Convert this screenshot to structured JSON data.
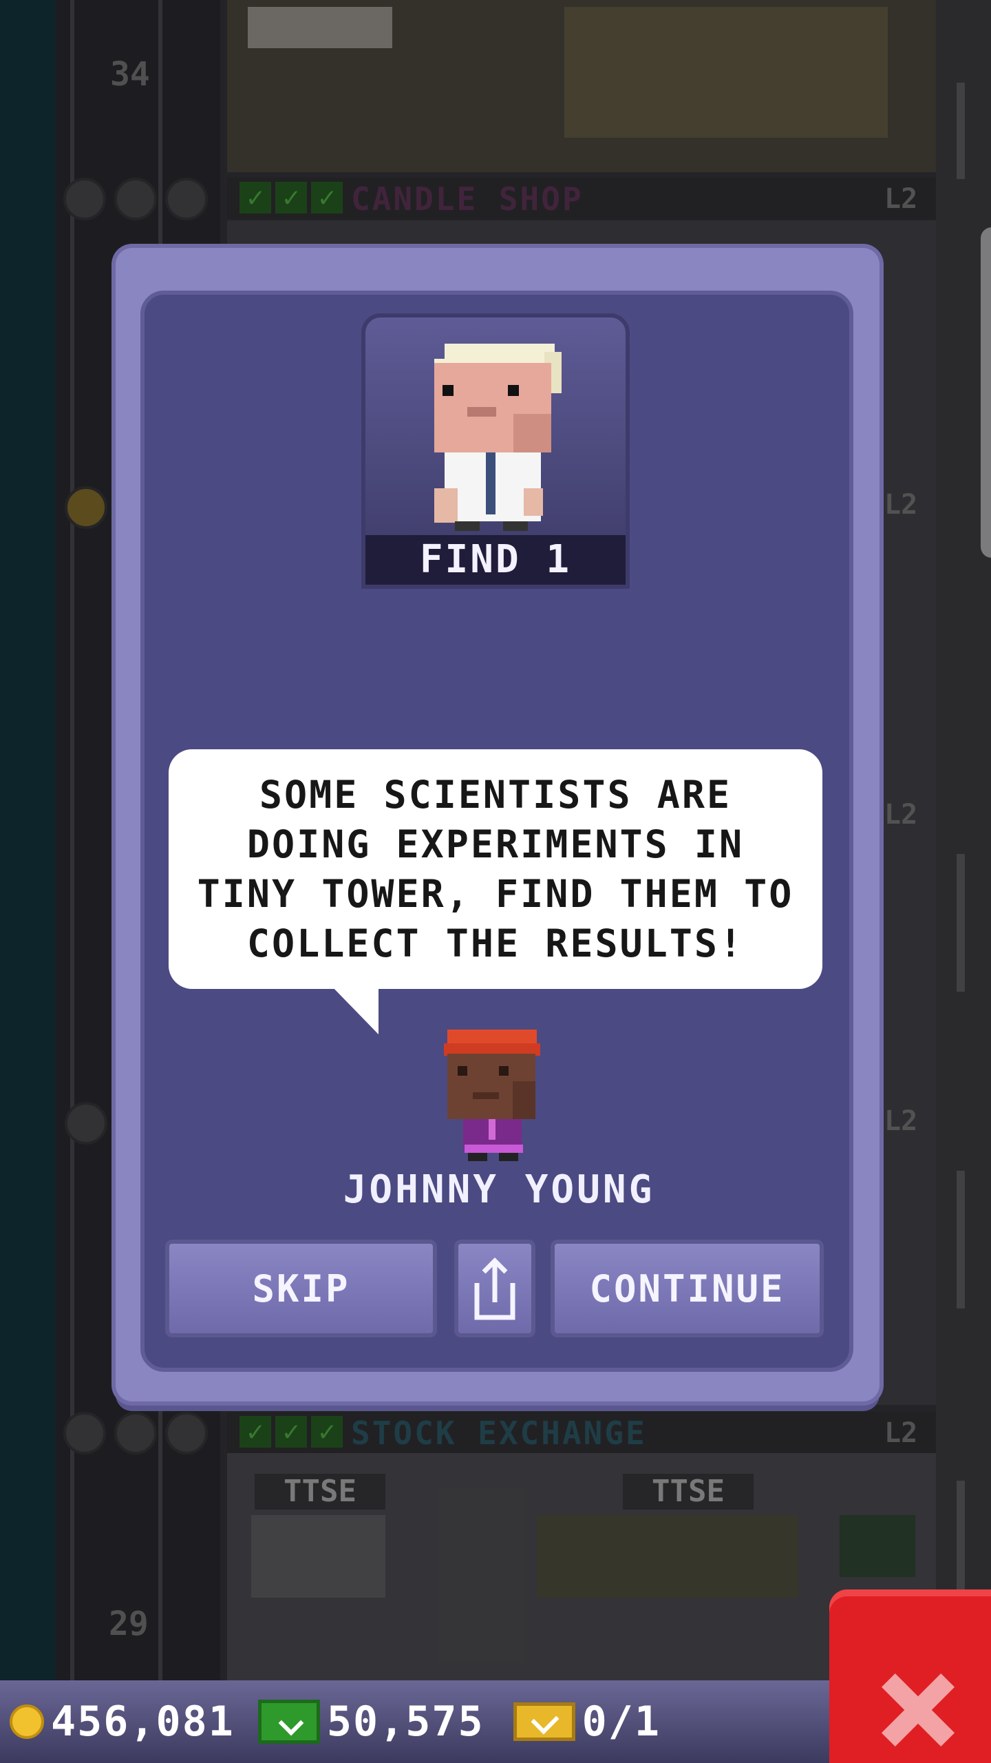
{
  "background": {
    "floors": [
      {
        "number": "34",
        "name": "CANDLE SHOP",
        "level": "L2",
        "name_color": "#4a2a45"
      },
      {
        "number": "",
        "name": "STOCK EXCHANGE",
        "level": "L2",
        "name_color": "#244650"
      },
      {
        "number": "29",
        "name": "",
        "level": "",
        "name_color": ""
      }
    ],
    "side_levels": [
      "L2",
      "L2",
      "L2"
    ],
    "ticker_signs": [
      "TTSE",
      "TTSE"
    ]
  },
  "dialog": {
    "mission_label": "FIND 1",
    "speech_text": "SOME SCIENTISTS ARE\nDOING EXPERIMENTS IN\nTINY TOWER, FIND THEM TO\nCOLLECT THE RESULTS!",
    "speaker_name": "JOHNNY YOUNG",
    "buttons": {
      "skip": "SKIP",
      "continue": "CONTINUE",
      "share_icon": "share-icon"
    }
  },
  "bottom_bar": {
    "coins": "456,081",
    "bux": "50,575",
    "tickets": "0/1"
  },
  "colors": {
    "dialog_frame": "#8a86c2",
    "dialog_inner": "#4c4a82",
    "close_button": "#e01f24"
  }
}
